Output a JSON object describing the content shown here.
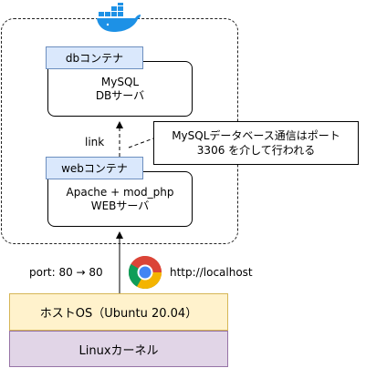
{
  "colors": {
    "container_tab_fill": "#dae8fc",
    "container_tab_border": "#6c8ebf",
    "host_os_fill": "#fff2cc",
    "host_os_border": "#d6b656",
    "kernel_fill": "#e1d5e7",
    "kernel_border": "#9673a6",
    "docker_blue": "#1d91e6"
  },
  "icons": {
    "docker": "docker-whale-logo",
    "browser": "chrome-logo"
  },
  "db_container": {
    "tab_label": "dbコンテナ",
    "line1": "MySQL",
    "line2": "DBサーバ"
  },
  "web_container": {
    "tab_label": "webコンテナ",
    "line1": "Apache + mod_php",
    "line2": "WEBサーバ"
  },
  "link_label": "link",
  "callout": {
    "line1": "MySQLデータベース通信はポート",
    "line2": "3306 を介して行われる"
  },
  "port_label": "port: 80 → 80",
  "url_label": "http://localhost",
  "host_os_label": "ホストOS（Ubuntu 20.04）",
  "kernel_label": "Linuxカーネル"
}
